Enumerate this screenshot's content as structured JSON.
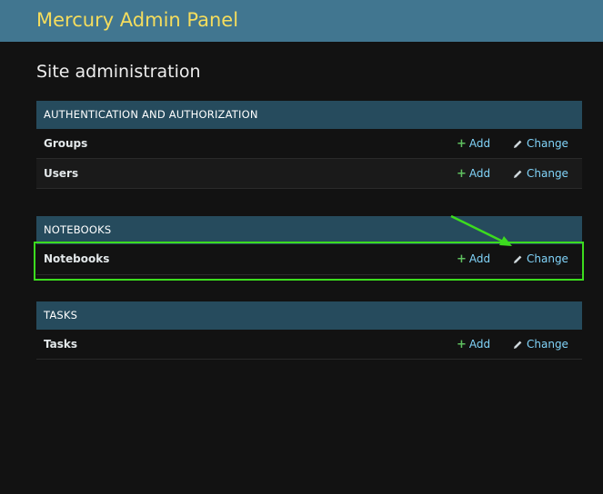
{
  "header": {
    "site_name": "Mercury Admin Panel"
  },
  "page": {
    "title": "Site administration"
  },
  "modules": [
    {
      "caption": "AUTHENTICATION AND AUTHORIZATION",
      "rows": [
        {
          "name": "Groups",
          "add_label": "Add",
          "change_label": "Change"
        },
        {
          "name": "Users",
          "add_label": "Add",
          "change_label": "Change"
        }
      ]
    },
    {
      "caption": "NOTEBOOKS",
      "rows": [
        {
          "name": "Notebooks",
          "add_label": "Add",
          "change_label": "Change"
        }
      ]
    },
    {
      "caption": "TASKS",
      "rows": [
        {
          "name": "Tasks",
          "add_label": "Add",
          "change_label": "Change"
        }
      ]
    }
  ],
  "icons": {
    "add": "plus-icon",
    "change": "pencil-icon"
  },
  "colors": {
    "header_bg": "#417690",
    "site_name": "#f5dd5d",
    "caption_bg": "#264b5d",
    "link": "#81d4fa",
    "add_icon": "#5fbf5f",
    "highlight": "#3cdc1e",
    "background": "#121212"
  },
  "annotation": {
    "highlighted_row": "Notebooks",
    "arrow_target": "change-link"
  }
}
